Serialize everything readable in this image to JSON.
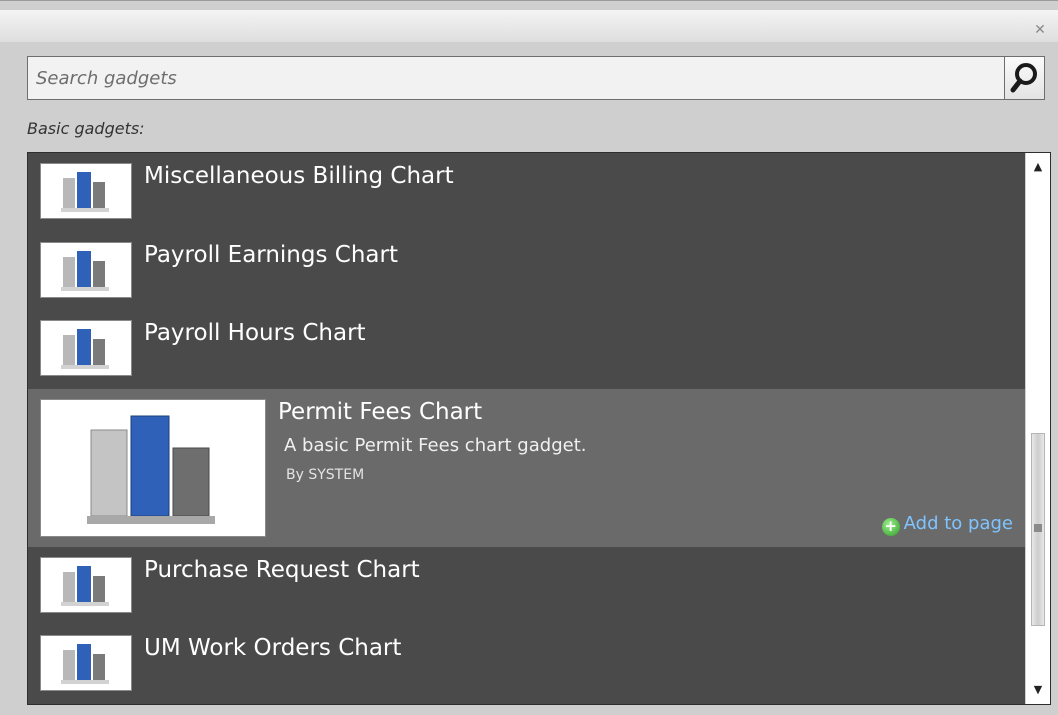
{
  "search": {
    "placeholder": "Search gadgets"
  },
  "section_label": "Basic gadgets:",
  "gadgets": [
    {
      "title": "Miscellaneous Billing Chart"
    },
    {
      "title": "Payroll Earnings Chart"
    },
    {
      "title": "Payroll Hours Chart"
    },
    {
      "title": "Permit Fees Chart",
      "description": "A basic Permit Fees chart gadget.",
      "author": "By SYSTEM",
      "add_label": "Add to page"
    },
    {
      "title": "Purchase Request Chart"
    },
    {
      "title": "UM Work Orders Chart"
    }
  ],
  "icons": {
    "close": "close-icon",
    "search": "search-icon",
    "add": "add-icon",
    "chart_thumb": "bar-chart-thumbnail-icon"
  },
  "colors": {
    "list_bg": "#4a4a4a",
    "selected_bg": "#6a6a6a",
    "link": "#7fc4ff"
  }
}
